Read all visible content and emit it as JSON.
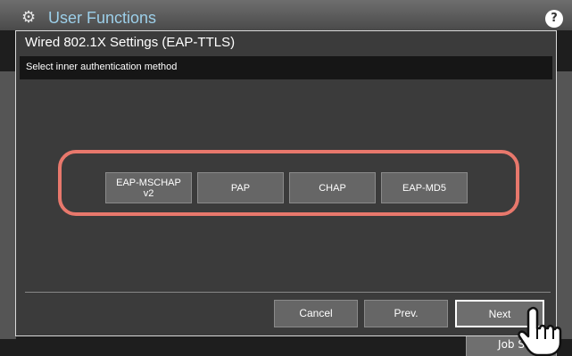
{
  "background": {
    "app_title": "User Functions",
    "help_icon": "question-icon",
    "job_button_label": "Job S"
  },
  "dialog": {
    "title": "Wired 802.1X Settings (EAP-TTLS)",
    "instruction": "Select inner authentication method",
    "options": [
      {
        "line1": "EAP-MSCHAP",
        "line2": "v2"
      },
      {
        "line1": "PAP",
        "line2": ""
      },
      {
        "line1": "CHAP",
        "line2": ""
      },
      {
        "line1": "EAP-MD5",
        "line2": ""
      }
    ],
    "footer": {
      "cancel_label": "Cancel",
      "prev_label": "Prev.",
      "next_label": "Next"
    }
  },
  "colors": {
    "highlight": "#e8786c",
    "dialog_bg": "#3b3b3b",
    "button_bg": "#666666"
  }
}
